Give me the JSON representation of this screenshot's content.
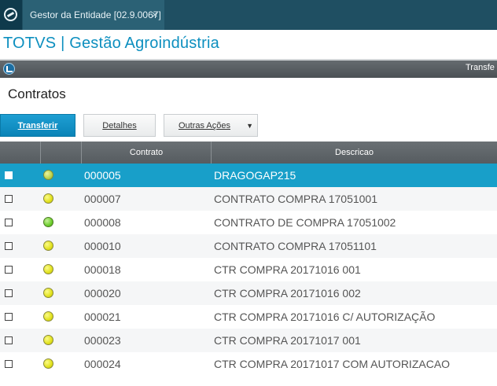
{
  "titlebar": {
    "tab_label": "Gestor da Entidade [02.9.0067]",
    "close_glyph": "×"
  },
  "brand": {
    "text": "TOTVS | Gestão Agroindústria"
  },
  "toolstrip": {
    "title_fragment": "Transfe"
  },
  "page": {
    "title": "Contratos"
  },
  "buttons": {
    "transfer": "Transferir",
    "details": "Detalhes",
    "other_actions": "Outras Ações",
    "caret": "▼"
  },
  "grid": {
    "columns": [
      "",
      "",
      "Contrato",
      "Descricao"
    ],
    "rows": [
      {
        "contrato": "000005",
        "descricao": "DRAGOGAP215",
        "status": "yellow-green",
        "selected": true
      },
      {
        "contrato": "000007",
        "descricao": "CONTRATO COMPRA 17051001",
        "status": "yellow",
        "selected": false
      },
      {
        "contrato": "000008",
        "descricao": "CONTRATO DE COMPRA 17051002",
        "status": "green",
        "selected": false
      },
      {
        "contrato": "000010",
        "descricao": "CONTRATO COMPRA 17051101",
        "status": "yellow",
        "selected": false
      },
      {
        "contrato": "000018",
        "descricao": "CTR COMPRA 20171016 001",
        "status": "yellow",
        "selected": false
      },
      {
        "contrato": "000020",
        "descricao": "CTR COMPRA 20171016 002",
        "status": "yellow",
        "selected": false
      },
      {
        "contrato": "000021",
        "descricao": "CTR COMPRA 20171016 C/ AUTORIZAÇÃO",
        "status": "yellow",
        "selected": false
      },
      {
        "contrato": "000023",
        "descricao": "CTR COMPRA 20171017 001",
        "status": "yellow",
        "selected": false
      },
      {
        "contrato": "000024",
        "descricao": "CTR COMPRA 20171017 COM AUTORIZACAO",
        "status": "yellow",
        "selected": false
      }
    ]
  },
  "colors": {
    "accent": "#189fc9",
    "brand": "#0d8fbf",
    "titlebar": "#1f4f62"
  }
}
